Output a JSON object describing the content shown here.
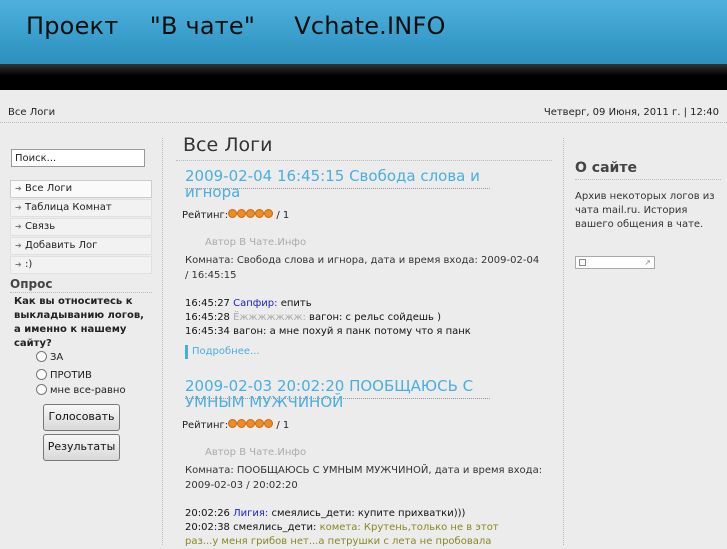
{
  "header": {
    "title": "Проект    \"В чате\"     Vchate.INFO"
  },
  "topbar": {
    "breadcrumb": "Все Логи",
    "datetime": "Четверг, 09 Июня, 2011 г. | 12:40"
  },
  "search": {
    "value": "Поиск..."
  },
  "menu": [
    {
      "label": "Все Логи",
      "active": true
    },
    {
      "label": "Таблица Комнат",
      "active": false
    },
    {
      "label": "Связь",
      "active": false
    },
    {
      "label": "Добавить Лог",
      "active": false
    },
    {
      "label": ":)",
      "active": false
    }
  ],
  "poll": {
    "title": "Опрос",
    "question": "Как вы относитесь к выкладыванию логов, а именно к нашему сайту?",
    "options": [
      "ЗА",
      "ПРОТИВ",
      "мне все-равно"
    ],
    "vote_label": "Голосовать",
    "results_label": "Результаты"
  },
  "main": {
    "title": "Все Логи",
    "posts": [
      {
        "title": "2009-02-04 16:45:15 Свобода слова и игнора",
        "rating_label": "Рейтинг:",
        "rating": "/ 1",
        "author": "Автор В Чате.Инфо",
        "meta": "Комната: Свобода слова и игнора, дата и время входа: 2009-02-04 / 16:45:15",
        "lines": [
          {
            "time": "16:45:27",
            "nick": "Сапфир:",
            "nick_color": "#2222cc",
            "text": "епить",
            "text_color": "#111111"
          },
          {
            "time": "16:45:28",
            "nick": "Ёжжжжжжж:",
            "nick_color": "#aaaaaa",
            "text": "вагон: с рельс сойдешь )",
            "text_color": "#111111"
          },
          {
            "time": "16:45:34",
            "nick": "вагон:",
            "nick_color": "#111111",
            "text": "а мне похуй я панк потому что я панк",
            "text_color": "#111111"
          }
        ],
        "more_label": "Подробнее..."
      },
      {
        "title": "2009-02-03 20:02:20 ПООБЩАЮСЬ С УМНЫМ МУЖЧИНОЙ",
        "rating_label": "Рейтинг:",
        "rating": "/ 1",
        "author": "Автор В Чате.Инфо",
        "meta": "Комната: ПООБЩАЮСЬ С УМНЫМ МУЖЧИНОЙ, дата и время входа: 2009-02-03 / 20:02:20",
        "lines": [
          {
            "time": "20:02:26",
            "nick": "Лигия:",
            "nick_color": "#2222cc",
            "text": "смеялись_дети: купите прихватки)))",
            "text_color": "#111111"
          },
          {
            "time": "20:02:38",
            "nick": "смеялись_дети:",
            "nick_color": "#111111",
            "text": "комета: Крутень,только не в этот",
            "text_color": "#888822"
          },
          {
            "time": "",
            "nick": "",
            "nick_color": "#888822",
            "text": "раз...у меня грибов нет...а петрушки с лета не пробовала",
            "text_color": "#888822"
          }
        ]
      }
    ]
  },
  "about": {
    "title": "О сайте",
    "text": "Архив некоторых логов из чата mail.ru. История вашего общения в чате."
  },
  "colors": {
    "header_blue": "#3a9fcc",
    "link_blue": "#49aee0",
    "rating_star": "#f08a22"
  },
  "icons": [
    "menu-arrow-icon",
    "radio-icon",
    "rating-star-icon"
  ]
}
